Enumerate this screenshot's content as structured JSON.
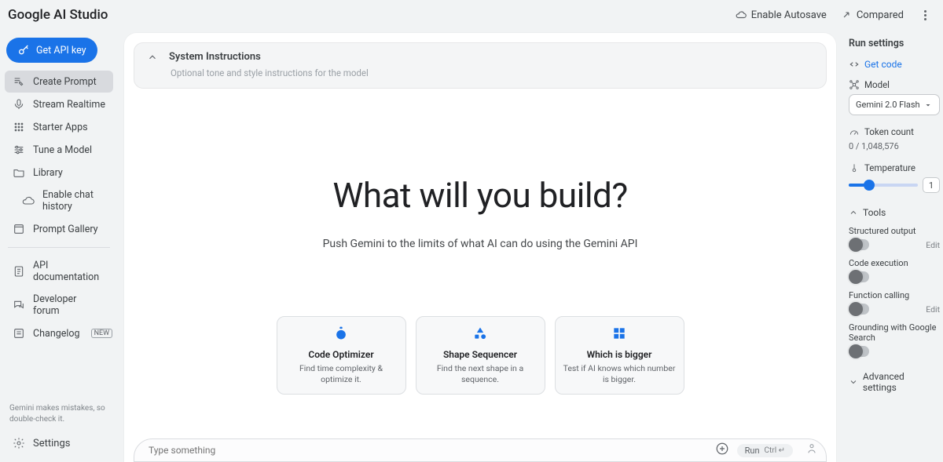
{
  "topbar": {
    "title": "Google AI Studio",
    "autosave": "Enable Autosave",
    "compared": "Compared"
  },
  "sidebar": {
    "get_api": "Get API key",
    "items": [
      {
        "label": "Create Prompt"
      },
      {
        "label": "Stream Realtime"
      },
      {
        "label": "Starter Apps"
      },
      {
        "label": "Tune a Model"
      },
      {
        "label": "Library"
      },
      {
        "label": "Enable chat history"
      },
      {
        "label": "Prompt Gallery"
      }
    ],
    "bottom": [
      {
        "label": "API documentation"
      },
      {
        "label": "Developer forum"
      },
      {
        "label": "Changelog",
        "badge": "NEW"
      }
    ],
    "disclaimer": "Gemini makes mistakes, so double-check it.",
    "settings": "Settings"
  },
  "sysbox": {
    "title": "System Instructions",
    "subtitle": "Optional tone and style instructions for the model"
  },
  "hero": {
    "headline": "What will you build?",
    "subline": "Push Gemini to the limits of what AI can do using the Gemini API"
  },
  "cards": [
    {
      "title": "Code Optimizer",
      "desc": "Find time complexity & optimize it."
    },
    {
      "title": "Shape Sequencer",
      "desc": "Find the next shape in a sequence."
    },
    {
      "title": "Which is bigger",
      "desc": "Test if AI knows which number is bigger."
    }
  ],
  "prompt": {
    "placeholder": "Type something",
    "run": "Run",
    "shortcut": "Ctrl ↵"
  },
  "run": {
    "title": "Run settings",
    "get_code": "Get code",
    "model_label": "Model",
    "model_value": "Gemini 2.0 Flash",
    "token_label": "Token count",
    "token_value": "0 / 1,048,576",
    "temp_label": "Temperature",
    "temp_value": "1",
    "tools_label": "Tools",
    "tools": [
      {
        "name": "Structured output",
        "edit": "Edit"
      },
      {
        "name": "Code execution"
      },
      {
        "name": "Function calling",
        "edit": "Edit"
      },
      {
        "name": "Grounding with Google Search"
      }
    ],
    "advanced": "Advanced settings"
  }
}
